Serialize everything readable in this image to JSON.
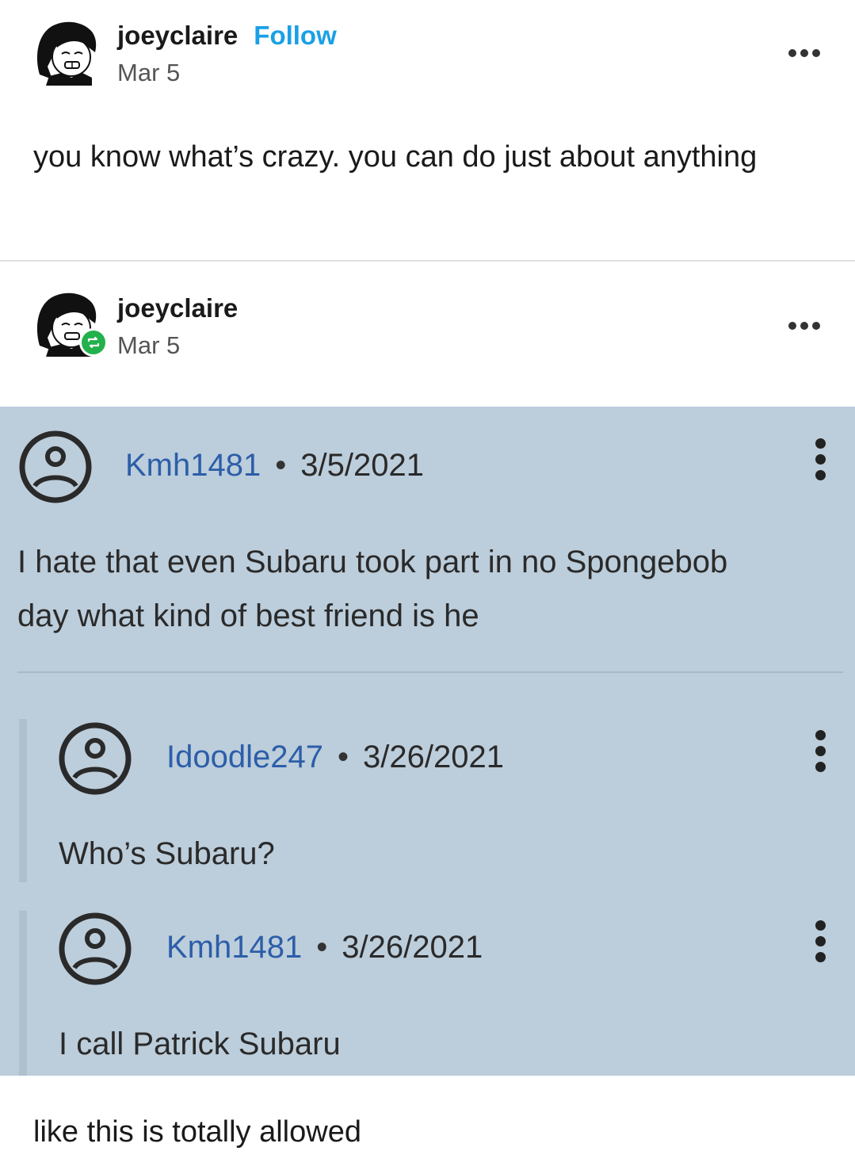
{
  "post": {
    "author": "joeyclaire",
    "follow_label": "Follow",
    "date": "Mar 5",
    "text": "you know what’s crazy. you can do just about anything"
  },
  "reblog": {
    "author": "joeyclaire",
    "date": "Mar 5",
    "caption": "like this is totally allowed"
  },
  "screenshot": {
    "comments": [
      {
        "user": "Kmh1481",
        "separator": "•",
        "date": "3/5/2021",
        "text": "I hate that even Subaru took part in no Spongebob day what kind of best friend is he"
      },
      {
        "user": "Idoodle247",
        "separator": "•",
        "date": "3/26/2021",
        "text": "Who’s Subaru?"
      },
      {
        "user": "Kmh1481",
        "separator": "•",
        "date": "3/26/2021",
        "text": "I call Patrick Subaru"
      }
    ]
  },
  "icons": {
    "more": "more-horizontal-icon",
    "reblog": "reblog-icon",
    "comment_more": "more-vertical-icon",
    "default_avatar": "default-user-avatar-icon"
  },
  "colors": {
    "follow": "#1aa0e6",
    "reblog_badge": "#22b14c",
    "screenshot_bg": "#bccddb",
    "comment_user": "#2c5ea8"
  }
}
